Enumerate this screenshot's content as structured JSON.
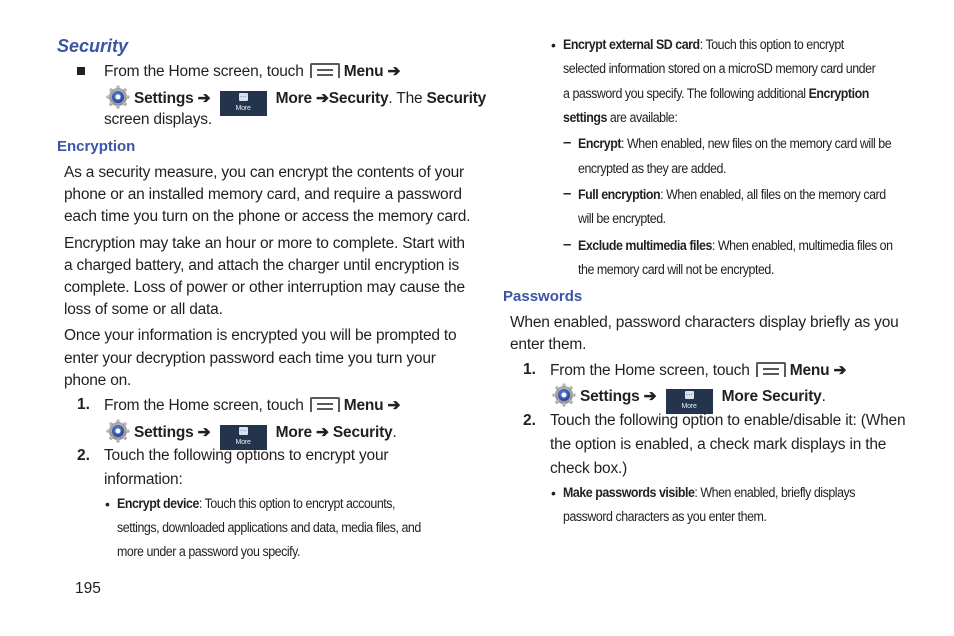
{
  "page_number": "195",
  "left": {
    "title": "Security",
    "intro": {
      "line1_text": "From the Home screen, touch",
      "menu_label": "Menu ➔",
      "settings_label": "Settings ➔",
      "more_icon_text": "More",
      "more_path": "More ➔Security",
      "tail_text": ". The ",
      "tail_bold": "Security",
      "line3": "screen displays."
    },
    "encryption": {
      "heading": "Encryption",
      "para1": [
        "As a security measure, you can encrypt the contents of your",
        "phone or an installed memory card, and require a password",
        "each time you turn on the phone or access the memory card."
      ],
      "para2": [
        "Encryption may take an hour or more to complete. Start with",
        "a charged battery, and attach the charger until encryption is",
        "complete. Loss of power or other interruption may cause the",
        "loss of some or all data."
      ],
      "para3": [
        "Once your information is encrypted you will be prompted to",
        "enter your decryption password each time you turn your",
        "phone on."
      ],
      "step1": {
        "num": "1.",
        "text": "From the Home screen, touch",
        "menu_label": "Menu ➔",
        "settings_label": "Settings ➔",
        "more_icon_text": "More",
        "more_path": "More ➔ Security",
        "end": "."
      },
      "step2": {
        "num": "2.",
        "lines": [
          "Touch the following options to encrypt your",
          "information:"
        ]
      },
      "encrypt_device": {
        "bullet": "•",
        "term": "Encrypt device",
        "line1": ": Touch this option to encrypt accounts,",
        "line2": "settings, downloaded applications and data, media files, and",
        "line3": "more under a password you specify."
      }
    }
  },
  "right": {
    "encrypt_sd": {
      "bullet": "•",
      "term": "Encrypt external SD card",
      "line1": ": Touch this option to encrypt",
      "line2": "selected information stored on a microSD memory card under",
      "line3_pre": "a password you specify. The following additional ",
      "line3_bold": "Encryption",
      "line4_bold": "settings",
      "line4_post": " are available:"
    },
    "sub_options": [
      {
        "dash": "–",
        "term": "Encrypt",
        "line1": ": When enabled, new files on the memory card will be",
        "line2": "encrypted as they are added."
      },
      {
        "dash": "–",
        "term": "Full encryption",
        "line1": ": When enabled, all files on the memory card",
        "line2": "will be encrypted."
      },
      {
        "dash": "–",
        "term": "Exclude multimedia files",
        "line1": ": When enabled, multimedia files on",
        "line2": "the memory card will not be encrypted."
      }
    ],
    "passwords": {
      "heading": "Passwords",
      "para": [
        "When enabled, password characters display briefly as you",
        "enter them."
      ],
      "step1": {
        "num": "1.",
        "text": "From the Home screen, touch",
        "menu_label": "Menu ➔",
        "settings_label": "Settings ➔",
        "more_icon_text": "More",
        "more_path": "More Security",
        "end": "."
      },
      "step2": {
        "num": "2.",
        "lines": [
          "Touch the following option to enable/disable it: (When",
          "the option is enabled, a check mark displays in the",
          "check box.)"
        ]
      },
      "make_visible": {
        "bullet": "•",
        "term": "Make passwords visible",
        "line1": ": When enabled, briefly displays",
        "line2": "password characters as you enter them."
      }
    }
  },
  "icons": {
    "menu": "menu-key-icon",
    "settings": "settings-gear-icon",
    "more": "more-tab-icon"
  },
  "colors": {
    "heading": "#3a55a6",
    "text": "#231f20",
    "more_icon_bg": "#24344d"
  }
}
